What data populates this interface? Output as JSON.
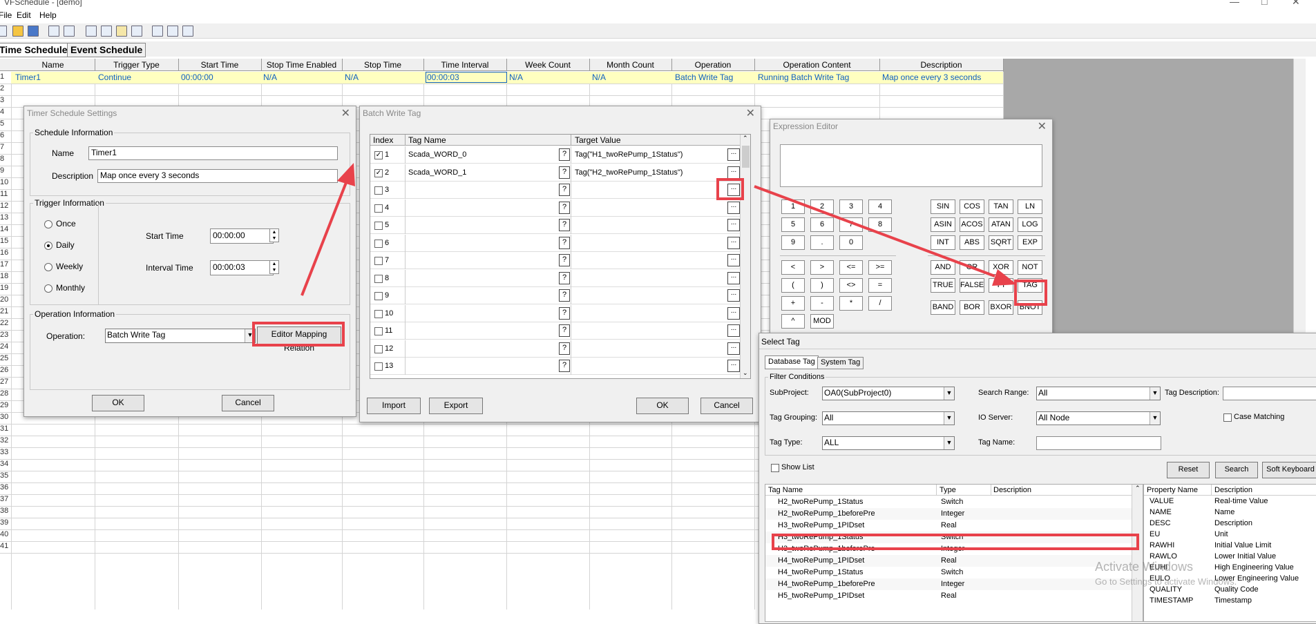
{
  "app": {
    "title": "VFSchedule - [demo]",
    "menu": [
      "File",
      "Edit",
      "Help"
    ],
    "tabs": [
      "Time Schedule",
      "Event Schedule"
    ]
  },
  "grid": {
    "columns": [
      "Name",
      "Trigger Type",
      "Start Time",
      "Stop Time Enabled",
      "Stop Time",
      "Time Interval",
      "Week Count",
      "Month Count",
      "Operation",
      "Operation Content",
      "Description"
    ],
    "row1": [
      "Timer1",
      "Continue",
      "00:00:00",
      "N/A",
      "N/A",
      "00:00:03",
      "N/A",
      "N/A",
      "Batch Write Tag",
      "Running Batch Write Tag",
      "Map once every 3 seconds"
    ],
    "row_numbers": [
      "1",
      "2",
      "3",
      "4",
      "5",
      "6",
      "7",
      "8",
      "9",
      "10",
      "11",
      "12",
      "13",
      "14",
      "15",
      "16",
      "17",
      "18",
      "19",
      "20",
      "21",
      "22",
      "23",
      "24",
      "25",
      "26",
      "27",
      "28",
      "29",
      "30",
      "31",
      "32",
      "33",
      "34",
      "35",
      "36",
      "37",
      "38",
      "39",
      "40",
      "41"
    ]
  },
  "timer_dialog": {
    "title": "Timer Schedule Settings",
    "schedule_group": "Schedule Information",
    "name_label": "Name",
    "name_value": "Timer1",
    "desc_label": "Description",
    "desc_value": "Map once every 3 seconds",
    "trigger_group": "Trigger Information",
    "radios": [
      "Once",
      "Daily",
      "Weekly",
      "Monthly"
    ],
    "selected_radio": "Daily",
    "start_label": "Start Time",
    "start_value": "00:00:00",
    "interval_label": "Interval Time",
    "interval_value": "00:00:03",
    "op_group": "Operation Information",
    "op_label": "Operation:",
    "op_value": "Batch Write Tag",
    "editor_button": "Editor Mapping Relation",
    "ok": "OK",
    "cancel": "Cancel"
  },
  "batch_dialog": {
    "title": "Batch Write Tag",
    "headers": [
      "Index",
      "Tag Name",
      "Target Value"
    ],
    "rows": [
      {
        "index": "1",
        "checked": true,
        "tag": "Scada_WORD_0",
        "value": "Tag(\"H1_twoRePump_1Status\")"
      },
      {
        "index": "2",
        "checked": true,
        "tag": "Scada_WORD_1",
        "value": "Tag(\"H2_twoRePump_1Status\")"
      },
      {
        "index": "3",
        "checked": false,
        "tag": "",
        "value": ""
      },
      {
        "index": "4",
        "checked": false,
        "tag": "",
        "value": ""
      },
      {
        "index": "5",
        "checked": false,
        "tag": "",
        "value": ""
      },
      {
        "index": "6",
        "checked": false,
        "tag": "",
        "value": ""
      },
      {
        "index": "7",
        "checked": false,
        "tag": "",
        "value": ""
      },
      {
        "index": "8",
        "checked": false,
        "tag": "",
        "value": ""
      },
      {
        "index": "9",
        "checked": false,
        "tag": "",
        "value": ""
      },
      {
        "index": "10",
        "checked": false,
        "tag": "",
        "value": ""
      },
      {
        "index": "11",
        "checked": false,
        "tag": "",
        "value": ""
      },
      {
        "index": "12",
        "checked": false,
        "tag": "",
        "value": ""
      },
      {
        "index": "13",
        "checked": false,
        "tag": "",
        "value": ""
      }
    ],
    "q": "?",
    "dots": "...",
    "import": "Import",
    "export": "Export",
    "ok": "OK",
    "cancel": "Cancel"
  },
  "expr_dialog": {
    "title": "Expression Editor",
    "keys_left": [
      [
        "1",
        "2",
        "3",
        "4"
      ],
      [
        "5",
        "6",
        "7",
        "8"
      ],
      [
        "9",
        ".",
        "0",
        ""
      ],
      [
        "<",
        ">",
        "<=",
        ">="
      ],
      [
        "(",
        ")",
        "<>",
        "="
      ],
      [
        "+",
        "-",
        "*",
        "/"
      ],
      [
        "^",
        "MOD",
        "",
        ""
      ]
    ],
    "keys_right": [
      [
        "SIN",
        "COS",
        "TAN",
        "LN"
      ],
      [
        "ASIN",
        "ACOS",
        "ATAN",
        "LOG"
      ],
      [
        "INT",
        "ABS",
        "SQRT",
        "EXP"
      ],
      [
        "AND",
        "OR",
        "XOR",
        "NOT"
      ],
      [
        "TRUE",
        "FALSE",
        "PI",
        "TAG"
      ],
      [
        "BAND",
        "BOR",
        "BXOR",
        "BNOT"
      ]
    ]
  },
  "select_tag": {
    "title": "Select Tag",
    "tabs": [
      "Database Tag",
      "System Tag"
    ],
    "filter_group": "Filter Conditions",
    "subproject_label": "SubProject:",
    "subproject_value": "OA0(SubProject0)",
    "search_range_label": "Search Range:",
    "search_range_value": "All",
    "tag_desc_label": "Tag Description:",
    "grouping_label": "Tag Grouping:",
    "grouping_value": "All",
    "io_label": "IO Server:",
    "io_value": "All Node",
    "case_label": "Case Matching",
    "type_label": "Tag Type:",
    "type_value": "ALL",
    "tagname_label": "Tag Name:",
    "show_list": "Show List",
    "reset": "Reset",
    "search": "Search",
    "soft_keyboard": "Soft Keyboard",
    "list_headers": [
      "Tag Name",
      "Type",
      "Description"
    ],
    "tags": [
      {
        "name": "H2_twoRePump_1Status",
        "type": "Switch"
      },
      {
        "name": "H2_twoRePump_1beforePre",
        "type": "Integer"
      },
      {
        "name": "H3_twoRePump_1PIDset",
        "type": "Real"
      },
      {
        "name": "H3_twoRePump_1Status",
        "type": "Switch"
      },
      {
        "name": "H3_twoRePump_1beforePre",
        "type": "Integer"
      },
      {
        "name": "H4_twoRePump_1PIDset",
        "type": "Real"
      },
      {
        "name": "H4_twoRePump_1Status",
        "type": "Switch"
      },
      {
        "name": "H4_twoRePump_1beforePre",
        "type": "Integer"
      },
      {
        "name": "H5_twoRePump_1PIDset",
        "type": "Real"
      }
    ],
    "prop_headers": [
      "Property Name",
      "Description"
    ],
    "props": [
      {
        "name": "VALUE",
        "desc": "Real-time Value"
      },
      {
        "name": "NAME",
        "desc": "Name"
      },
      {
        "name": "DESC",
        "desc": "Description"
      },
      {
        "name": "EU",
        "desc": "Unit"
      },
      {
        "name": "RAWHI",
        "desc": "Initial Value Limit"
      },
      {
        "name": "RAWLO",
        "desc": "Lower Initial Value"
      },
      {
        "name": "EUHI",
        "desc": "High Engineering Value"
      },
      {
        "name": "EULO",
        "desc": "Lower Engineering Value"
      },
      {
        "name": "QUALITY",
        "desc": "Quality Code"
      },
      {
        "name": "TIMESTAMP",
        "desc": "Timestamp"
      }
    ]
  },
  "watermark": {
    "line1": "Activate Windows",
    "line2": "Go to Settings to activate Windows."
  }
}
